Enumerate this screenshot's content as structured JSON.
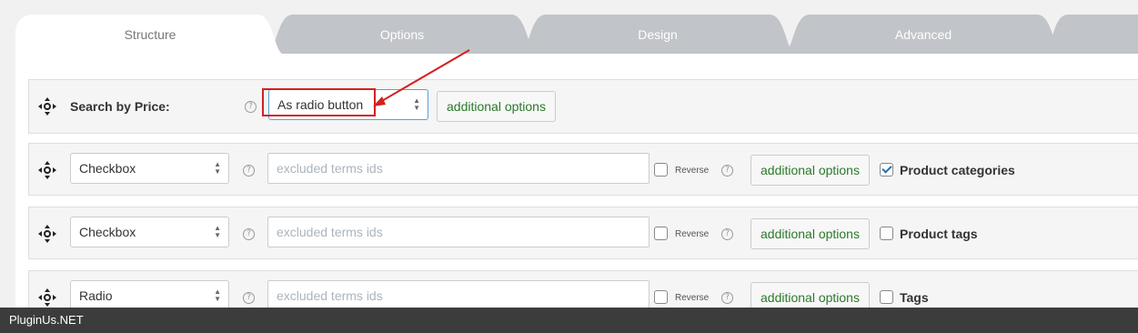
{
  "tabs": [
    "Structure",
    "Options",
    "Design",
    "Advanced"
  ],
  "price_row": {
    "label": "Search by Price:",
    "select_value": "As radio button",
    "button_label": "additional options"
  },
  "rows": [
    {
      "select_value": "Checkbox",
      "input_placeholder": "excluded terms ids",
      "reverse_label": "Reverse",
      "button_label": "additional options",
      "tax_label": "Product categories",
      "checked": true
    },
    {
      "select_value": "Checkbox",
      "input_placeholder": "excluded terms ids",
      "reverse_label": "Reverse",
      "button_label": "additional options",
      "tax_label": "Product tags",
      "checked": false
    },
    {
      "select_value": "Radio",
      "input_placeholder": "excluded terms ids",
      "reverse_label": "Reverse",
      "button_label": "additional options",
      "tax_label": "Tags",
      "checked": false
    }
  ],
  "footer": {
    "brand": "PluginUs.NET"
  },
  "colors": {
    "accent_green": "#2a7a2a",
    "annotation_red": "#d32020",
    "tab_inactive": "#c1c4c8"
  }
}
